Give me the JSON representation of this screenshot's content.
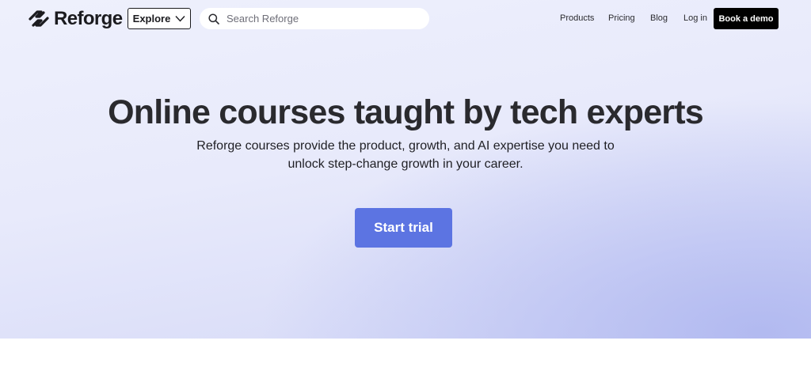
{
  "header": {
    "logo_text": "Reforge",
    "explore_label": "Explore",
    "search_placeholder": "Search Reforge",
    "nav": {
      "products": "Products",
      "pricing": "Pricing",
      "blog": "Blog",
      "login": "Log in"
    },
    "demo_label": "Book a demo"
  },
  "hero": {
    "headline": "Online courses taught by tech experts",
    "subline_1": "Reforge courses provide the product, growth, and AI expertise you need to",
    "subline_2": "unlock step-change growth in your career.",
    "cta_label": "Start trial"
  },
  "colors": {
    "cta": "#5c74e2",
    "demo_button": "#000000",
    "hero_bg": "#e8eafb"
  }
}
